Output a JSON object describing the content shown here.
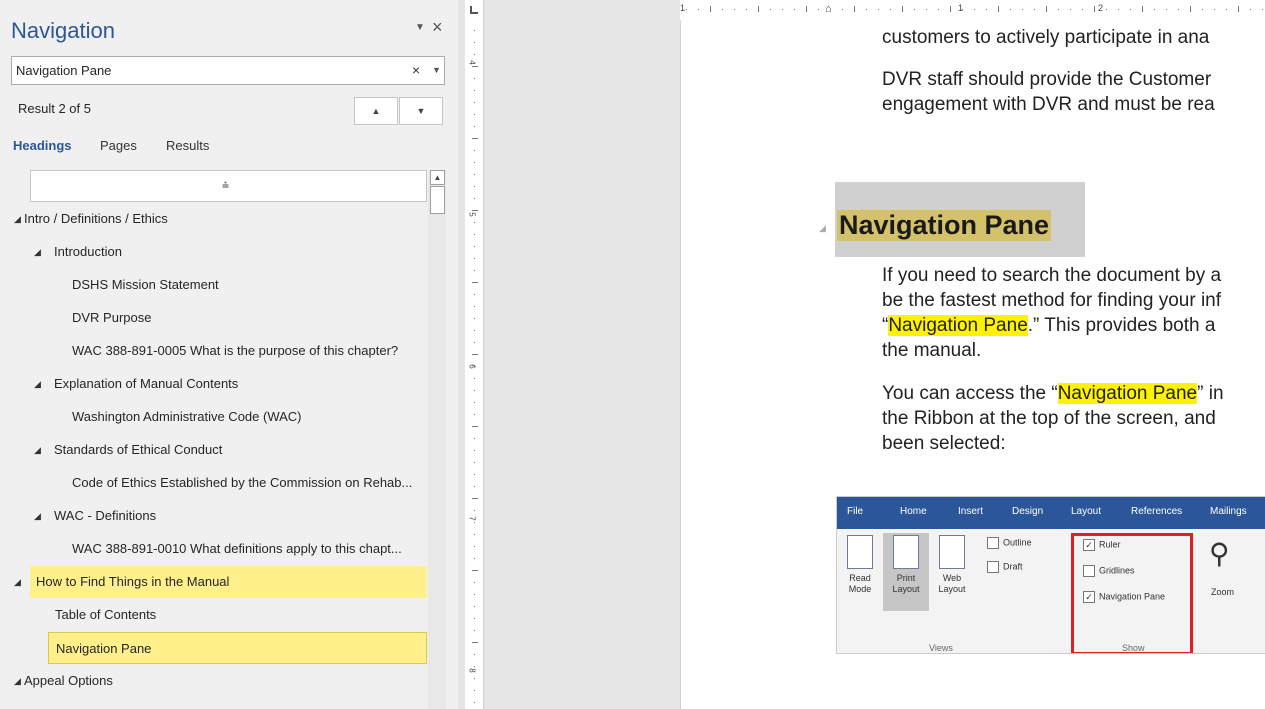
{
  "navigation": {
    "title": "Navigation",
    "search": {
      "value": "Navigation Pane",
      "placeholder": ""
    },
    "result_text": "Result 2 of 5",
    "tabs": [
      "Headings",
      "Pages",
      "Results"
    ],
    "tree": [
      {
        "label": "Intro / Definitions / Ethics",
        "level": 0,
        "expanded": true
      },
      {
        "label": "Introduction",
        "level": 1,
        "expanded": true
      },
      {
        "label": "DSHS Mission Statement",
        "level": 2
      },
      {
        "label": "DVR Purpose",
        "level": 2
      },
      {
        "label": "WAC 388-891-0005 What is the purpose of this chapter?",
        "level": 2
      },
      {
        "label": "Explanation of Manual Contents",
        "level": 1,
        "expanded": true
      },
      {
        "label": "Washington Administrative Code (WAC)",
        "level": 2
      },
      {
        "label": "Standards of Ethical Conduct",
        "level": 1,
        "expanded": true
      },
      {
        "label": "Code of Ethics Established by the Commission on Rehab...",
        "level": 2
      },
      {
        "label": "WAC - Definitions",
        "level": 1,
        "expanded": true
      },
      {
        "label": "WAC 388-891-0010  What definitions apply to this chapt...",
        "level": 2
      },
      {
        "label": "How to Find Things in the Manual",
        "level": 0,
        "expanded": true,
        "highlight": true
      },
      {
        "label": "Table of Contents",
        "level": 1
      },
      {
        "label": "Navigation Pane",
        "level": 1,
        "highlight": true,
        "selected": true
      },
      {
        "label": "Appeal Options",
        "level": 0,
        "expanded": true
      }
    ]
  },
  "vertical_ruler": {
    "numbers": [
      "4",
      "5",
      "6",
      "7",
      "8"
    ]
  },
  "horizontal_ruler": {
    "numbers": [
      "1",
      "1",
      "2"
    ]
  },
  "document": {
    "lines_top": [
      "customers to actively participate in ana",
      "DVR staff should provide the Customer",
      "engagement with DVR and must be rea"
    ],
    "heading": "Navigation Pane",
    "para1": {
      "line1": "If you need to search the document by a",
      "line2": "be the fastest method for finding your inf",
      "line3_pre": "“",
      "line3_mark": "Navigation Pane",
      "line3_post": ".” This provides both a",
      "line4": "the manual."
    },
    "para2": {
      "line1_pre": "You can access the “",
      "line1_mark": "Navigation Pane",
      "line1_post": "” in",
      "line2": "the Ribbon at the top of the screen, and",
      "line3": "been selected:"
    },
    "highlight_color": "#fff200"
  },
  "ribbon_image": {
    "tabs": [
      "File",
      "Home",
      "Insert",
      "Design",
      "Layout",
      "References",
      "Mailings"
    ],
    "views": {
      "read_mode": [
        "Read",
        "Mode"
      ],
      "print_layout": [
        "Print",
        "Layout"
      ],
      "web_layout": [
        "Web",
        "Layout"
      ],
      "outline": "Outline",
      "draft": "Draft",
      "group_label": "Views"
    },
    "show": {
      "ruler": "Ruler",
      "gridlines": "Gridlines",
      "navigation_pane": "Navigation Pane",
      "group_label": "Show",
      "ruler_checked": true,
      "gridlines_checked": false,
      "navigation_pane_checked": true
    },
    "zoom": "Zoom",
    "tab_color": "#2b579a",
    "frame_color": "#e02020"
  }
}
